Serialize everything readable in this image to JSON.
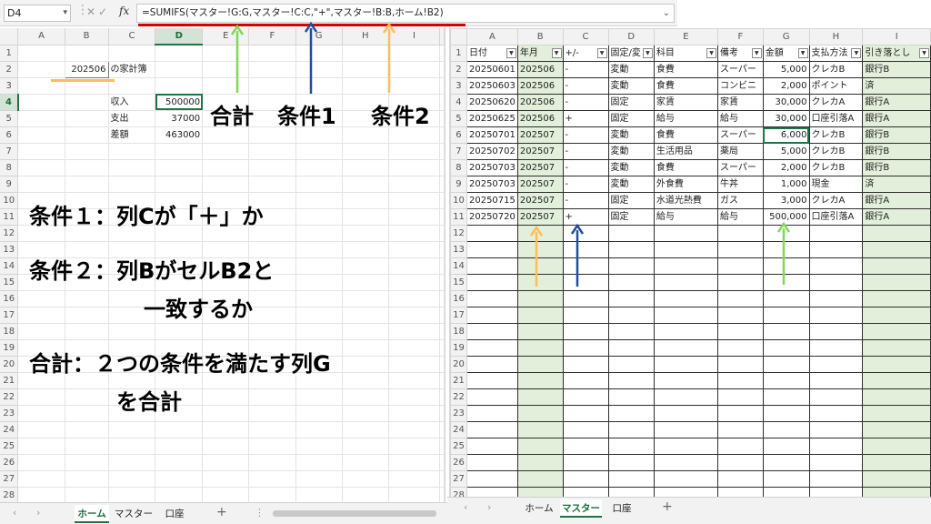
{
  "formula_bar": {
    "name_box": "D4",
    "fx_symbol": "fx",
    "formula": "=SUMIFS(マスター!G:G,マスター!C:C,\"+\",マスター!B:B,ホーム!B2)"
  },
  "home_sheet": {
    "columns": [
      "A",
      "B",
      "C",
      "D",
      "E",
      "F",
      "G",
      "H",
      "I"
    ],
    "rows": [
      "1",
      "2",
      "3",
      "4",
      "5",
      "6",
      "7",
      "8",
      "9",
      "10",
      "11",
      "12",
      "13",
      "14",
      "15",
      "16",
      "17",
      "18",
      "19",
      "20",
      "21",
      "22",
      "23",
      "24",
      "25",
      "26",
      "27",
      "28"
    ],
    "b2_value": "202506",
    "title_suffix": "の家計簿",
    "income_label": "収入",
    "income_value": "500000",
    "expense_label": "支出",
    "expense_value": "37000",
    "diff_label": "差額",
    "diff_value": "463000"
  },
  "master_sheet": {
    "columns": [
      "A",
      "B",
      "C",
      "D",
      "E",
      "F",
      "G",
      "H",
      "I"
    ],
    "headers": [
      "日付",
      "年月",
      "+/-",
      "固定/変",
      "科目",
      "備考",
      "金額",
      "支払方法",
      "引き落とし"
    ],
    "rows": [
      [
        "20250601",
        "202506",
        "-",
        "変動",
        "食費",
        "スーパー",
        "5,000",
        "クレカB",
        "銀行B"
      ],
      [
        "20250603",
        "202506",
        "-",
        "変動",
        "食費",
        "コンビニ",
        "2,000",
        "ポイント",
        "済"
      ],
      [
        "20250620",
        "202506",
        "-",
        "固定",
        "家賃",
        "家賃",
        "30,000",
        "クレカA",
        "銀行A"
      ],
      [
        "20250625",
        "202506",
        "+",
        "固定",
        "給与",
        "給与",
        "30,000",
        "口座引落A",
        "銀行A"
      ],
      [
        "20250701",
        "202507",
        "-",
        "変動",
        "食費",
        "スーパー",
        "6,000",
        "クレカB",
        "銀行B"
      ],
      [
        "20250702",
        "202507",
        "-",
        "変動",
        "生活用品",
        "薬局",
        "5,000",
        "クレカB",
        "銀行B"
      ],
      [
        "20250703",
        "202507",
        "-",
        "変動",
        "食費",
        "スーパー",
        "2,000",
        "クレカB",
        "銀行B"
      ],
      [
        "20250703",
        "202507",
        "-",
        "変動",
        "外食費",
        "牛丼",
        "1,000",
        "現金",
        "済"
      ],
      [
        "20250715",
        "202507",
        "-",
        "固定",
        "水道光熱費",
        "ガス",
        "3,000",
        "クレカA",
        "銀行A"
      ],
      [
        "20250720",
        "202507",
        "+",
        "固定",
        "給与",
        "給与",
        "500,000",
        "口座引落A",
        "銀行A"
      ]
    ],
    "row_numbers": [
      "1",
      "2",
      "3",
      "4",
      "5",
      "6",
      "7",
      "8",
      "9",
      "10",
      "11",
      "12",
      "13",
      "14",
      "15",
      "16",
      "17",
      "18",
      "19",
      "20",
      "21",
      "22",
      "23",
      "24",
      "25",
      "26",
      "27",
      "28"
    ]
  },
  "annotations": {
    "label_sum": "合計",
    "label_cond1": "条件1",
    "label_cond2": "条件2",
    "cond1_text": "条件１：列Cが「＋」か",
    "cond2_line1": "条件２：列BがセルB2と",
    "cond2_line2": "一致するか",
    "sum_line1": "合計：２つの条件を満たす列G",
    "sum_line2": "を合計"
  },
  "tabs_left": {
    "items": [
      "ホーム",
      "マスター",
      "口座"
    ],
    "active": "ホーム"
  },
  "tabs_right": {
    "items": [
      "ホーム",
      "マスター",
      "口座"
    ],
    "active": "マスター"
  },
  "colors": {
    "green_arrow": "#7ed957",
    "blue_arrow": "#1f4e9e",
    "orange_arrow": "#ffbd59",
    "red_underline": "#d40000",
    "highlight_column": "#e2efda"
  }
}
